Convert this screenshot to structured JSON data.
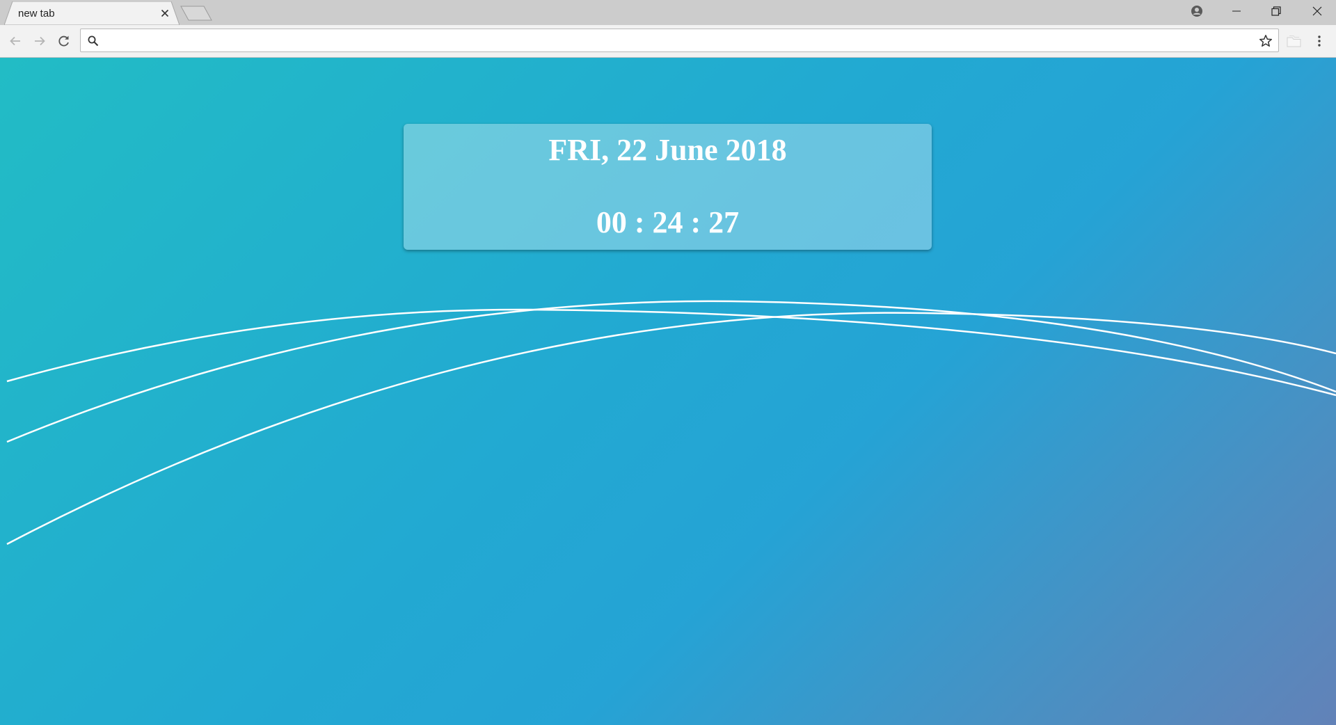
{
  "tab": {
    "title": "new tab"
  },
  "omnibox": {
    "value": "",
    "placeholder": ""
  },
  "clock": {
    "date": "FRI, 22 June 2018",
    "time": "00 : 24 : 27"
  },
  "icons": {
    "tab_close": "close-icon",
    "new_tab": "new-tab-icon",
    "profile": "account-circle-icon",
    "minimize": "minimize-icon",
    "maximize": "restore-icon",
    "close": "close-icon",
    "back": "arrow-left-icon",
    "forward": "arrow-right-icon",
    "reload": "reload-icon",
    "search": "search-icon",
    "bookmark": "star-outline-icon",
    "extension": "folder-icon",
    "menu": "kebab-menu-icon"
  },
  "colors": {
    "background_gradient_start": "#22bcc5",
    "background_gradient_mid": "#22a9d2",
    "background_gradient_end": "#6282b8",
    "clock_text": "#ffffff",
    "arc_stroke": "#ffffff"
  }
}
